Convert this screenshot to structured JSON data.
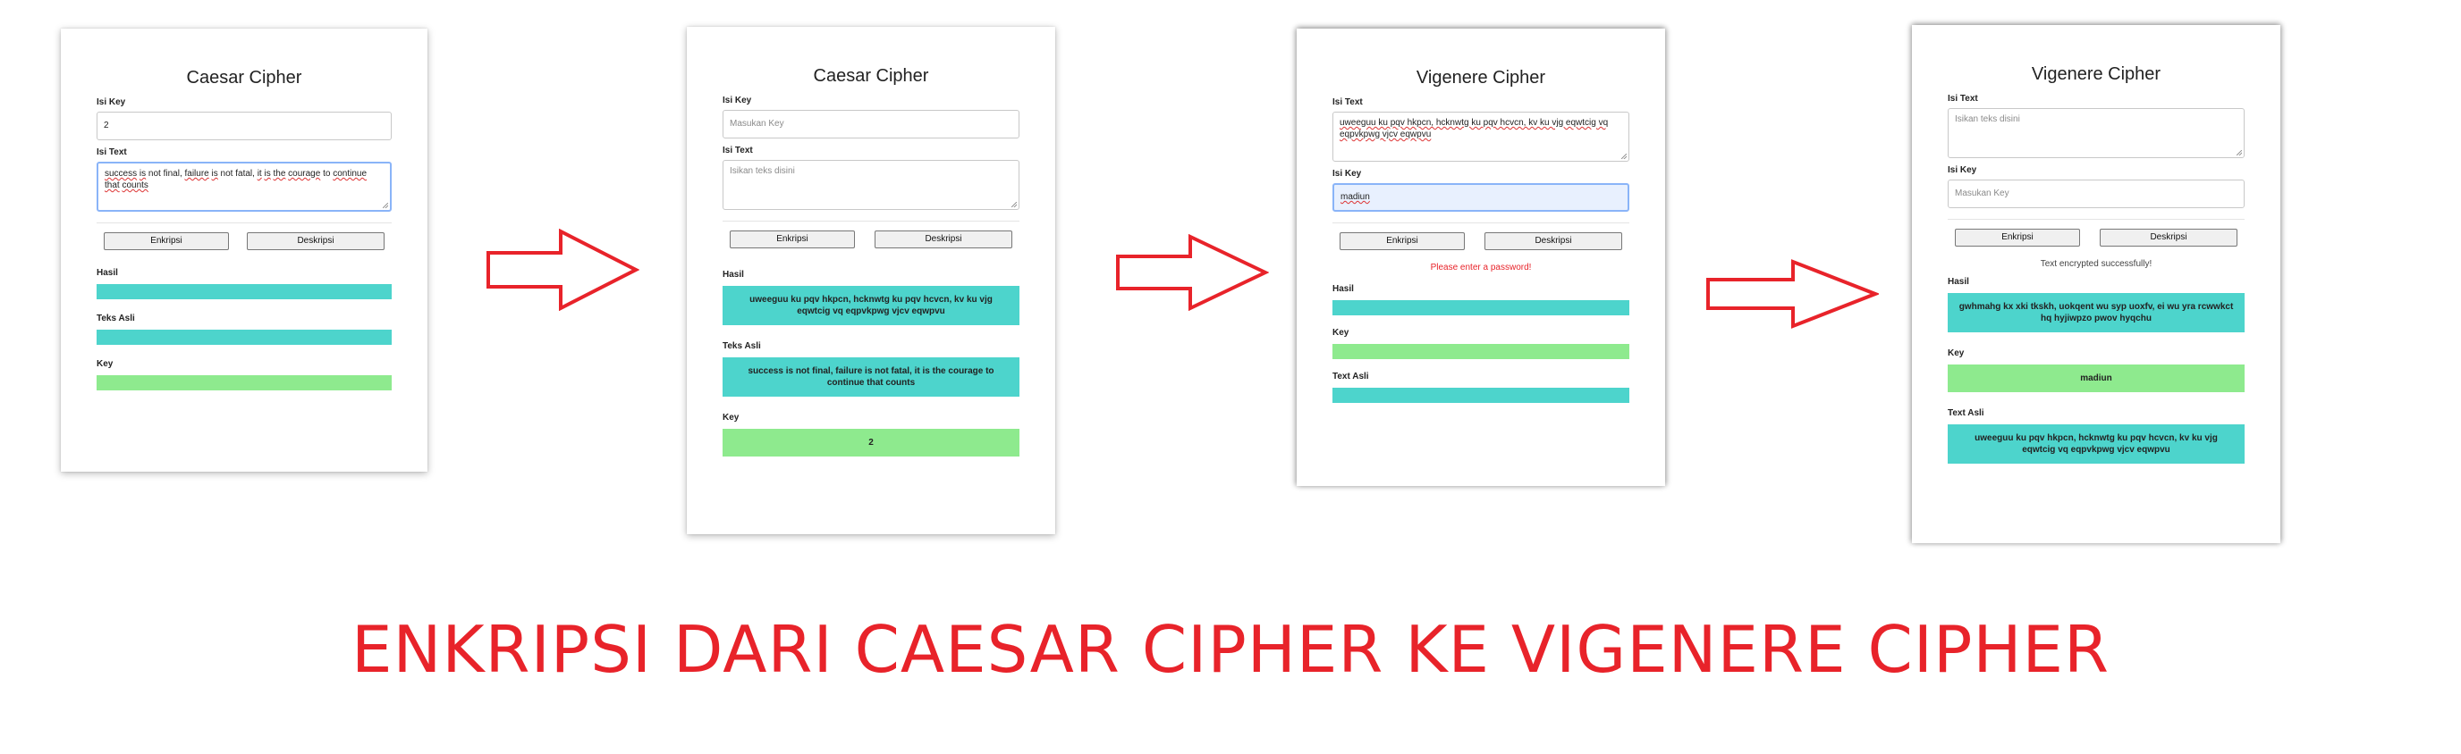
{
  "panel1": {
    "title": "Caesar Cipher",
    "key_label": "Isi Key",
    "key_value": "2",
    "text_label": "Isi Text",
    "text_words": [
      "success",
      " ",
      "is",
      " not final, ",
      "failure",
      " ",
      "is",
      " not fatal, ",
      "it",
      " ",
      "is",
      " ",
      "the",
      " ",
      "courage",
      " to ",
      "continue",
      " ",
      "that",
      " ",
      "counts"
    ],
    "encrypt_label": "Enkripsi",
    "decrypt_label": "Deskripsi",
    "result_label": "Hasil",
    "original_label": "Teks Asli",
    "keyout_label": "Key"
  },
  "panel2": {
    "title": "Caesar Cipher",
    "key_label": "Isi Key",
    "key_placeholder": "Masukan Key",
    "text_label": "Isi Text",
    "text_placeholder": "Isikan teks disini",
    "encrypt_label": "Enkripsi",
    "decrypt_label": "Deskripsi",
    "result_label": "Hasil",
    "result_value": "uweeguu ku pqv hkpcn, hcknwtg ku pqv hcvcn, kv ku vjg eqwtcig vq eqpvkpwg vjcv eqwpvu",
    "original_label": "Teks Asli",
    "original_value": "success is not final, failure is not fatal, it is the courage to continue that counts",
    "keyout_label": "Key",
    "keyout_value": "2"
  },
  "panel3": {
    "title": "Vigenere Cipher",
    "text_label": "Isi Text",
    "text_value": "uweeguu ku pqv hkpcn, hcknwtg ku pqv hcvcn, kv ku vjg eqwtcig vq eqpvkpwg vjcv eqwpvu",
    "key_label": "Isi Key",
    "key_value": "madiun",
    "encrypt_label": "Enkripsi",
    "decrypt_label": "Deskripsi",
    "message": "Please enter a password!",
    "result_label": "Hasil",
    "keyout_label": "Key",
    "original_label": "Text Asli"
  },
  "panel4": {
    "title": "Vigenere Cipher",
    "text_label": "Isi Text",
    "text_placeholder": "Isikan teks disini",
    "key_label": "Isi Key",
    "key_placeholder": "Masukan Key",
    "encrypt_label": "Enkripsi",
    "decrypt_label": "Deskripsi",
    "message": "Text encrypted successfully!",
    "result_label": "Hasil",
    "result_value": "gwhmahg kx xki tkskh, uokqent wu syp uoxfv, ei wu yra rcwwkct hq hyjiwpzo pwov hyqchu",
    "keyout_label": "Key",
    "keyout_value": "madiun",
    "original_label": "Text Asli",
    "original_value": "uweeguu ku pqv hkpcn, hcknwtg ku pqv hcvcn, kv ku vjg eqwtcig vq eqpvkpwg vjcv eqwpvu"
  },
  "caption": "ENKRIPSI DARI CAESAR CIPHER KE VIGENERE CIPHER",
  "colors": {
    "teal": "#4dd4cc",
    "green": "#8eea8e",
    "accent_red": "#e8232a",
    "focus_blue": "#8ab4f8"
  },
  "icons": [
    "arrow-right-outline-icon"
  ]
}
